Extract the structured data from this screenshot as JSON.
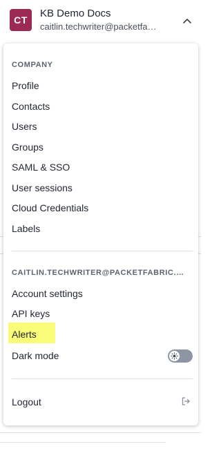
{
  "header": {
    "avatar_initials": "CT",
    "avatar_color": "#9c2a54",
    "org_name": "KB Demo Docs",
    "user_email": "caitlin.techwriter@packetfa…",
    "toggle_icon": "chevron-up-icon"
  },
  "menu": {
    "company_section": {
      "title": "COMPANY",
      "items": [
        "Profile",
        "Contacts",
        "Users",
        "Groups",
        "SAML & SSO",
        "User sessions",
        "Cloud Credentials",
        "Labels"
      ]
    },
    "user_section": {
      "title": "CAITLIN.TECHWRITER@PACKETFABRIC.…",
      "items": [
        "Account settings",
        "API keys",
        "Alerts"
      ],
      "highlighted_item": "Alerts",
      "highlight_color": "#fbfb7a"
    },
    "dark_mode": {
      "label": "Dark mode",
      "enabled": false,
      "icon": "sun-icon"
    },
    "logout": {
      "label": "Logout",
      "icon": "logout-icon"
    }
  }
}
